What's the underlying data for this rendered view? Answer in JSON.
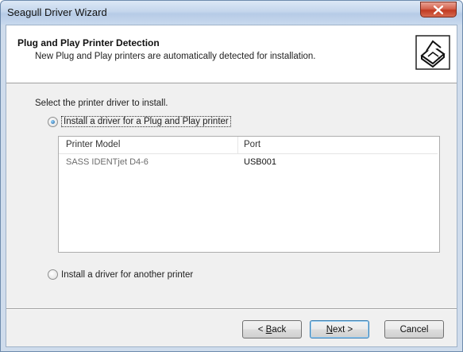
{
  "window": {
    "title": "Seagull Driver Wizard",
    "close_icon": "close-x-icon"
  },
  "header": {
    "title": "Plug and Play Printer Detection",
    "subtitle": "New Plug and Play printers are automatically detected for installation.",
    "icon": "printer-icon"
  },
  "body": {
    "prompt": "Select the printer driver to install.",
    "option_pnp": {
      "label": "Install a driver for a Plug and Play printer",
      "selected": true
    },
    "option_other": {
      "label": "Install a driver for another printer",
      "selected": false
    }
  },
  "printer_list": {
    "columns": [
      "Printer Model",
      "Port"
    ],
    "rows": [
      {
        "model": "SASS IDENTjet D4-6",
        "port": "USB001"
      }
    ]
  },
  "buttons": {
    "back": {
      "prefix": "< ",
      "accel": "B",
      "rest": "ack"
    },
    "next": {
      "accel": "N",
      "rest": "ext >"
    },
    "cancel": {
      "label": "Cancel"
    }
  },
  "colors": {
    "titlebar": "#c4d6ec",
    "close_button": "#c03a22",
    "default_button_border": "#3c7fb1"
  }
}
